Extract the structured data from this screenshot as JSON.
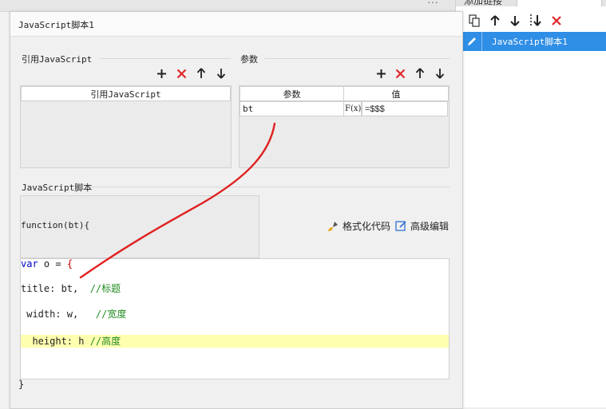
{
  "background": {
    "overflow_glyph": "···"
  },
  "right_panel": {
    "tab_label": "添加链接",
    "toolbar_icons": [
      "copy-icon",
      "arrow-up-icon",
      "arrow-down-icon",
      "move-bottom-icon",
      "delete-icon"
    ],
    "script_items": [
      {
        "label": "JavaScript脚本1",
        "selected": true
      }
    ]
  },
  "dialog": {
    "title": "JavaScript脚本1",
    "references": {
      "section_title": "引用JavaScript",
      "column_header": "引用JavaScript",
      "rows": []
    },
    "params": {
      "section_title": "参数",
      "columns": [
        "参数",
        "值"
      ],
      "rows": [
        {
          "name": "bt",
          "formula_icon": "F(x)",
          "value": "=$$$"
        }
      ]
    },
    "script": {
      "section_title": "JavaScript脚本",
      "function_header": "function(bt){",
      "format_button": "格式化代码",
      "advanced_button": "高级编辑",
      "code_lines": [
        {
          "keyword": "var",
          "text": " o = ",
          "brace": "{",
          "comment": ""
        },
        {
          "keyword": "",
          "text": "title: bt,  ",
          "brace": "",
          "comment": "//标题"
        },
        {
          "keyword": "",
          "text": " width: w,   ",
          "brace": "",
          "comment": "//宽度"
        },
        {
          "keyword": "",
          "text": "  height: h ",
          "brace": "",
          "comment": "//高度"
        }
      ],
      "closing_brace": "}"
    }
  },
  "colors": {
    "accent": "#2f8ee5",
    "delete": "#e0262a",
    "annotation": "#e02020",
    "highlight": "#ffffb0"
  }
}
